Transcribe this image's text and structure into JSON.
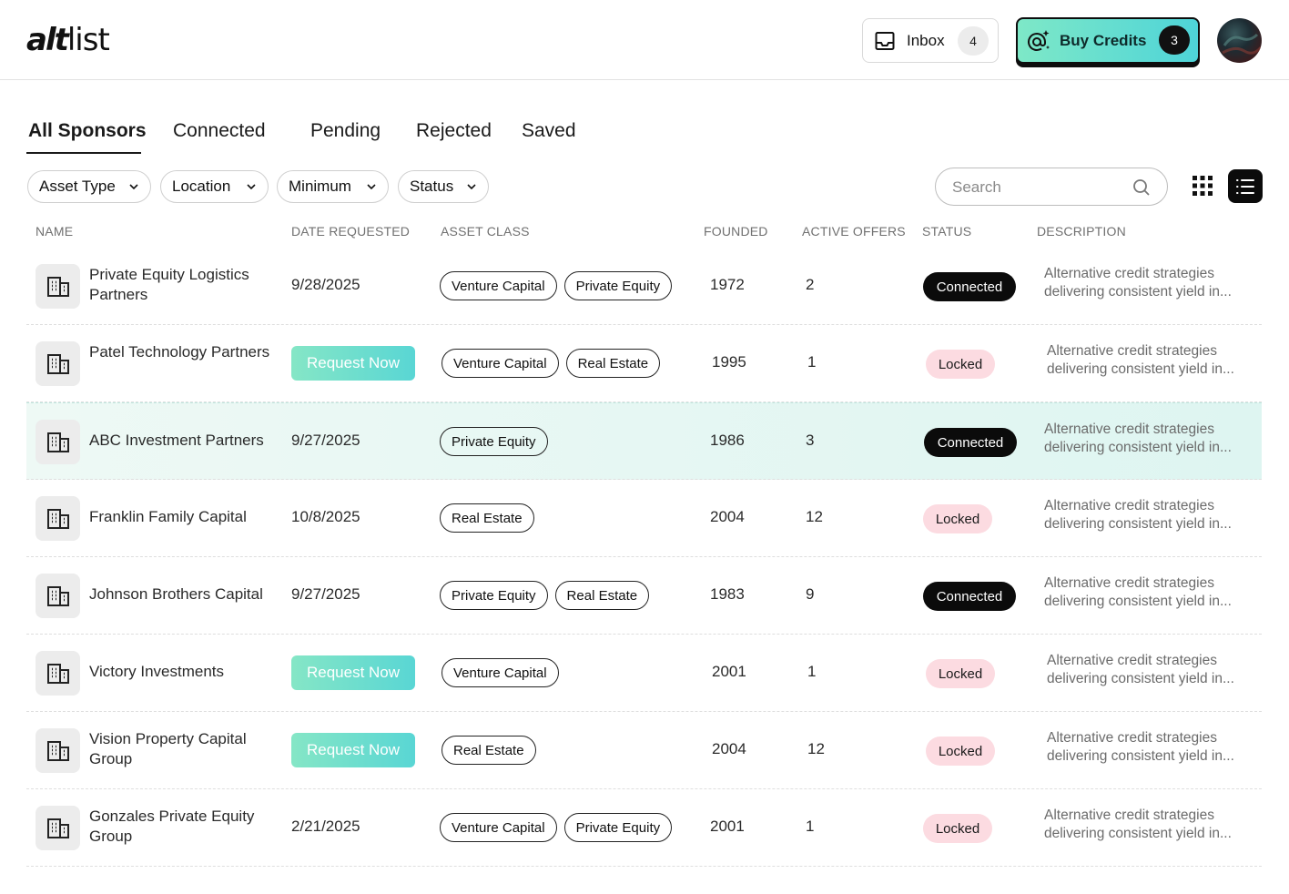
{
  "header": {
    "logo_bold": "alt",
    "logo_light": "list",
    "inbox_label": "Inbox",
    "inbox_count": "4",
    "credits_label": "Buy Credits",
    "credits_count": "3"
  },
  "tabs": [
    {
      "label": "All Sponsors",
      "active": true
    },
    {
      "label": "Connected"
    },
    {
      "label": "Pending"
    },
    {
      "label": "Rejected"
    },
    {
      "label": "Saved"
    }
  ],
  "filters": [
    "Asset Type",
    "Location",
    "Minimum",
    "Status"
  ],
  "search": {
    "placeholder": "Search"
  },
  "columns": [
    "NAME",
    "DATE REQUESTED",
    "ASSET CLASS",
    "FOUNDED",
    "ACTIVE OFFERS",
    "STATUS",
    "DESCRIPTION"
  ],
  "request_label": "Request Now",
  "rows": [
    {
      "name": "Private Equity Logistics Partners",
      "date": "9/28/2025",
      "tags": [
        "Venture Capital",
        "Private Equity"
      ],
      "founded": "1972",
      "offers": "2",
      "status": "Connected",
      "desc": "Alternative credit strategies delivering consistent yield in..."
    },
    {
      "name": "Patel Technology Partners",
      "date": "",
      "tags": [
        "Venture Capital",
        "Real Estate"
      ],
      "founded": "1995",
      "offers": "1",
      "status": "Locked",
      "desc": "Alternative credit strategies delivering consistent yield in..."
    },
    {
      "name": "ABC Investment Partners",
      "date": "9/27/2025",
      "tags": [
        "Private Equity"
      ],
      "founded": "1986",
      "offers": "3",
      "status": "Connected",
      "desc": "Alternative credit strategies delivering consistent yield in...",
      "highlight": true
    },
    {
      "name": "Franklin Family Capital",
      "date": "10/8/2025",
      "tags": [
        "Real Estate"
      ],
      "founded": "2004",
      "offers": "12",
      "status": "Locked",
      "desc": "Alternative credit strategies delivering consistent yield in..."
    },
    {
      "name": "Johnson Brothers Capital",
      "date": "9/27/2025",
      "tags": [
        "Private Equity",
        "Real Estate"
      ],
      "founded": "1983",
      "offers": "9",
      "status": "Connected",
      "desc": "Alternative credit strategies delivering consistent yield in..."
    },
    {
      "name": "Victory Investments",
      "date": "",
      "tags": [
        "Venture Capital"
      ],
      "founded": "2001",
      "offers": "1",
      "status": "Locked",
      "desc": "Alternative credit strategies delivering consistent yield in..."
    },
    {
      "name": "Vision Property Capital Group",
      "date": "",
      "tags": [
        "Real Estate"
      ],
      "founded": "2004",
      "offers": "12",
      "status": "Locked",
      "desc": "Alternative credit strategies delivering consistent yield in..."
    },
    {
      "name": "Gonzales Private Equity Group",
      "date": "2/21/2025",
      "tags": [
        "Venture Capital",
        "Private Equity"
      ],
      "founded": "2001",
      "offers": "1",
      "status": "Locked",
      "desc": "Alternative credit strategies delivering consistent yield in..."
    }
  ],
  "colors": {
    "accent_start": "#85e6c6",
    "accent_end": "#59d6d4",
    "connected": "#0b0b0b",
    "locked": "#fcdbe1",
    "highlight": "#def5f1"
  }
}
